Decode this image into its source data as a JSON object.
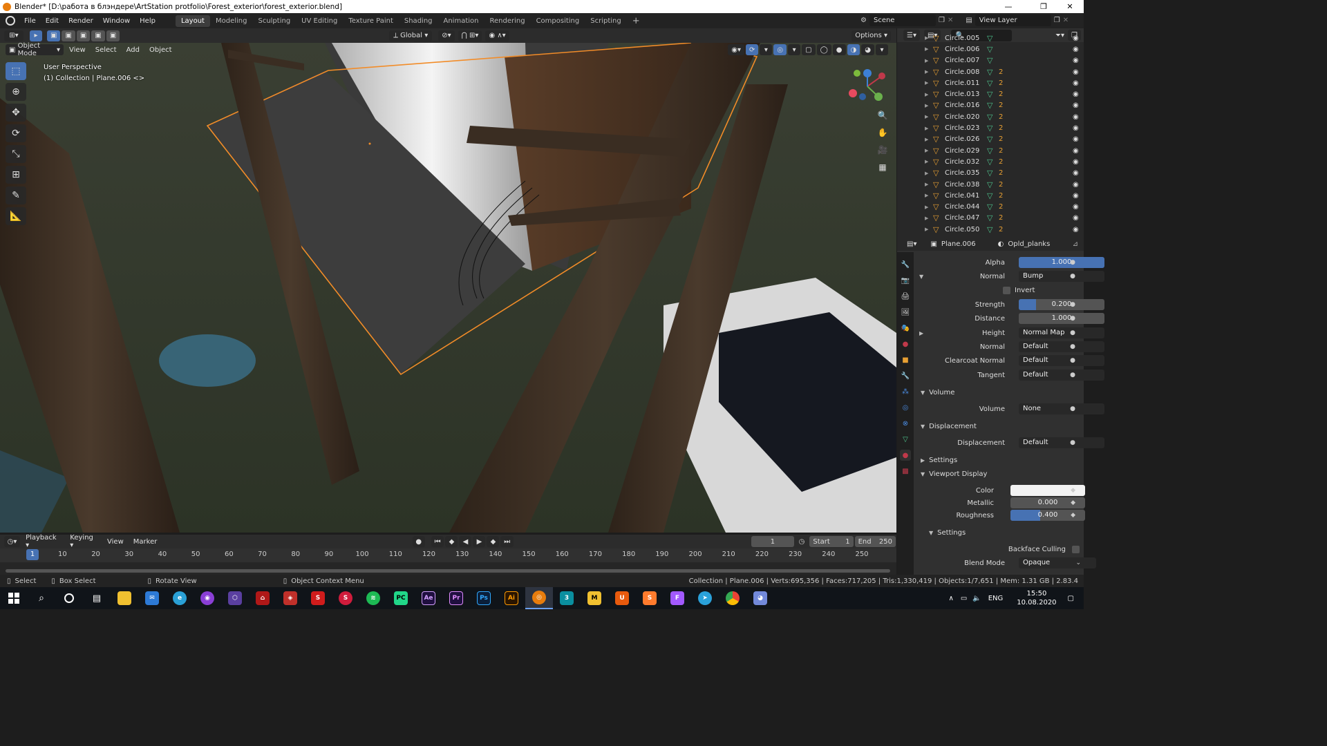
{
  "window": {
    "title": "Blender* [D:\\работа в блэндере\\ArtStation protfolio\\Forest_exterior\\forest_exterior.blend]",
    "minimize": "—",
    "maximize": "❐",
    "close": "✕"
  },
  "menu": {
    "file": "File",
    "edit": "Edit",
    "render": "Render",
    "window": "Window",
    "help": "Help"
  },
  "workspaces": [
    "Layout",
    "Modeling",
    "Sculpting",
    "UV Editing",
    "Texture Paint",
    "Shading",
    "Animation",
    "Rendering",
    "Compositing",
    "Scripting"
  ],
  "active_workspace": "Layout",
  "scene": {
    "name": "Scene",
    "view_layer": "View Layer"
  },
  "viewport_header": {
    "orientation": "Global",
    "options": "Options",
    "mode": "Object Mode",
    "menus": [
      "View",
      "Select",
      "Add",
      "Object"
    ]
  },
  "viewport_info": {
    "perspective": "User Perspective",
    "collection": "(1) Collection | Plane.006 <>"
  },
  "outliner": {
    "items": [
      "Circle.005",
      "Circle.006",
      "Circle.007",
      "Circle.008",
      "Circle.011",
      "Circle.013",
      "Circle.016",
      "Circle.020",
      "Circle.023",
      "Circle.026",
      "Circle.029",
      "Circle.032",
      "Circle.035",
      "Circle.038",
      "Circle.041",
      "Circle.044",
      "Circle.047",
      "Circle.050"
    ],
    "material_badges": [
      "",
      "",
      "",
      "2",
      "2",
      "2",
      "2",
      "2",
      "2",
      "2",
      "2",
      "2",
      "2",
      "2",
      "2",
      "2",
      "2",
      "2"
    ]
  },
  "properties": {
    "object": "Plane.006",
    "material": "Opld_planks",
    "alpha_label": "Alpha",
    "alpha": "1.000",
    "alpha_fill": 1.0,
    "normal_label": "Normal",
    "normal": "Bump",
    "invert_label": "Invert",
    "strength_label": "Strength",
    "strength": "0.200",
    "strength_fill": 0.2,
    "distance_label": "Distance",
    "distance": "1.000",
    "height_label": "Height",
    "height": "Normal Map",
    "normal2_label": "Normal",
    "normal2": "Default",
    "clearcoat_label": "Clearcoat Normal",
    "clearcoat": "Default",
    "tangent_label": "Tangent",
    "tangent": "Default",
    "volume_section": "Volume",
    "volume_label": "Volume",
    "volume": "None",
    "displacement_section": "Displacement",
    "displacement_label": "Displacement",
    "displacement": "Default",
    "settings_section": "Settings",
    "viewport_display_section": "Viewport Display",
    "color_label": "Color",
    "metallic_label": "Metallic",
    "metallic": "0.000",
    "roughness_label": "Roughness",
    "roughness": "0.400",
    "roughness_fill": 0.4,
    "settings_sub": "Settings",
    "backface_label": "Backface Culling",
    "blend_label": "Blend Mode",
    "blend": "Opaque"
  },
  "timeline": {
    "menus": [
      "Playback",
      "Keying",
      "View",
      "Marker"
    ],
    "current_frame": "1",
    "start_label": "Start",
    "start": "1",
    "end_label": "End",
    "end": "250",
    "ticks": [
      "1",
      "10",
      "20",
      "30",
      "40",
      "50",
      "60",
      "70",
      "80",
      "90",
      "100",
      "110",
      "120",
      "130",
      "140",
      "150",
      "160",
      "170",
      "180",
      "190",
      "200",
      "210",
      "220",
      "230",
      "240",
      "250"
    ]
  },
  "statusbar": {
    "select": "Select",
    "box_select": "Box Select",
    "rotate": "Rotate View",
    "context_menu": "Object Context Menu",
    "stats": "Collection | Plane.006 | Verts:695,356 | Faces:717,205 | Tris:1,330,419 | Objects:1/7,651 | Mem: 1.31 GB | 2.83.4"
  },
  "taskbar": {
    "apps": [
      "file-explorer",
      "mail",
      "edge",
      "podcast",
      "vs",
      "acrobat",
      "autodesk",
      "scrivener",
      "substance",
      "spotify",
      "pycharm",
      "after-effects",
      "premiere",
      "photoshop",
      "illustrator",
      "blender",
      "3ds",
      "marvelous",
      "blender-alt",
      "sublime",
      "figma",
      "telegram",
      "chrome",
      "discord"
    ],
    "app_labels": {
      "ae": "Ae",
      "pr": "Pr",
      "ps": "Ps",
      "ai": "Ai",
      "three": "3",
      "m": "M"
    },
    "lang": "ENG",
    "time": "15:50",
    "date": "10.08.2020"
  },
  "colors": {
    "accent": "#4772b3",
    "selection": "#e8a033",
    "object_icon": "#e8a033",
    "mesh_icon": "#4ec38c"
  }
}
